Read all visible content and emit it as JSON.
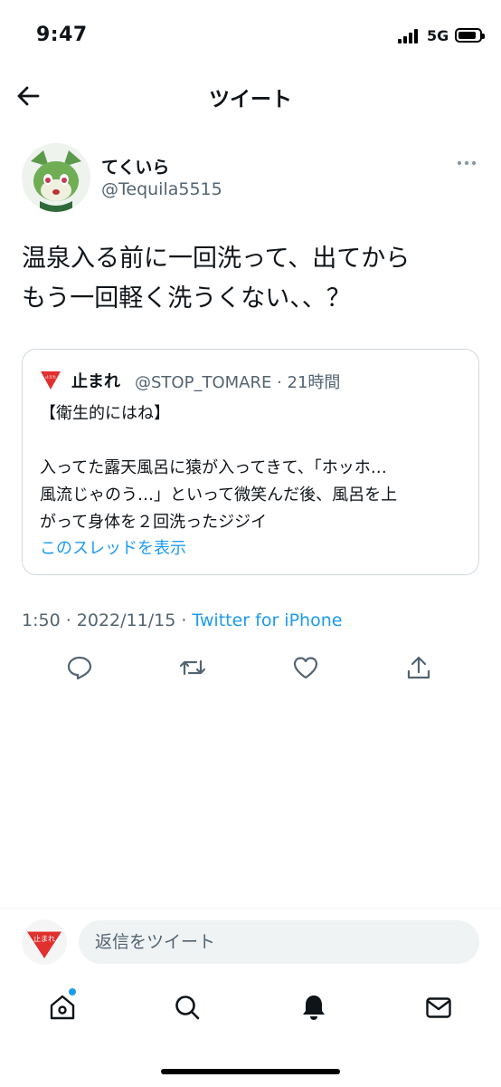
{
  "status_bar": {
    "time": "9:47",
    "network": "5G"
  },
  "header": {
    "title": "ツイート"
  },
  "tweet": {
    "display_name": "てくいら",
    "handle": "@Tequila5515",
    "text_lines": [
      "温泉入る前に一回洗って、出てから",
      "もう一回軽く洗うくない、、？"
    ],
    "timestamp": "1:50 · 2022/11/15 · ",
    "source": "Twitter for iPhone"
  },
  "quote": {
    "avatar_label": "止まれ",
    "name": "止まれ",
    "handle_time": "@STOP_TOMARE · 21時間",
    "lines": [
      "【衛生的にはね】",
      "",
      "入ってた露天風呂に猿が入ってきて、「ホッホ…",
      "風流じゃのう…」といって微笑んだ後、風呂を上",
      "がって身体を２回洗ったジジイ"
    ],
    "show_thread": "このスレッドを表示"
  },
  "reply": {
    "avatar_label": "止まれ",
    "placeholder": "返信をツイート"
  },
  "icons": {
    "back": "arrow-left-icon",
    "more": "more-icon",
    "actions": [
      "reply-icon",
      "retweet-icon",
      "like-icon",
      "share-icon"
    ],
    "tabs": [
      "home-icon",
      "search-icon",
      "notifications-icon",
      "messages-icon"
    ]
  },
  "colors": {
    "accent": "#1d9bf0",
    "secondary_text": "#536471",
    "stop_sign": "#e0312f"
  }
}
